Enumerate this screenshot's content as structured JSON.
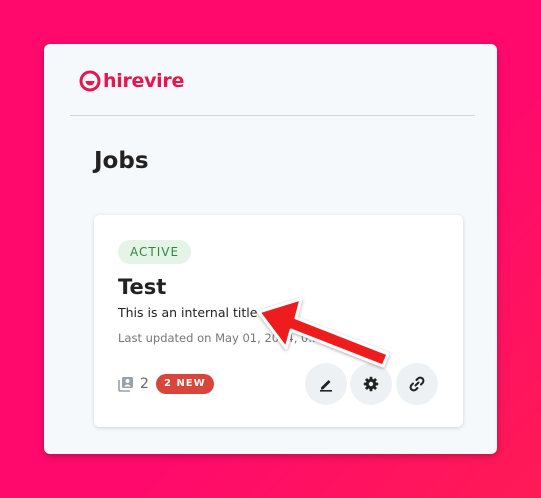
{
  "brand": {
    "name": "hirevire",
    "color": "#e8154f"
  },
  "page": {
    "title": "Jobs"
  },
  "job": {
    "status": "ACTIVE",
    "title": "Test",
    "internal_title": "This is an internal title",
    "last_updated": "Last updated on May 01, 2024, 0...",
    "candidate_count": "2",
    "new_badge": "2 NEW"
  },
  "actions": [
    {
      "icon": "edit-icon",
      "name": "edit-button"
    },
    {
      "icon": "gear-icon",
      "name": "settings-button"
    },
    {
      "icon": "link-icon",
      "name": "share-link-button"
    }
  ],
  "annotation": {
    "type": "arrow",
    "color": "#ee1c1c"
  }
}
